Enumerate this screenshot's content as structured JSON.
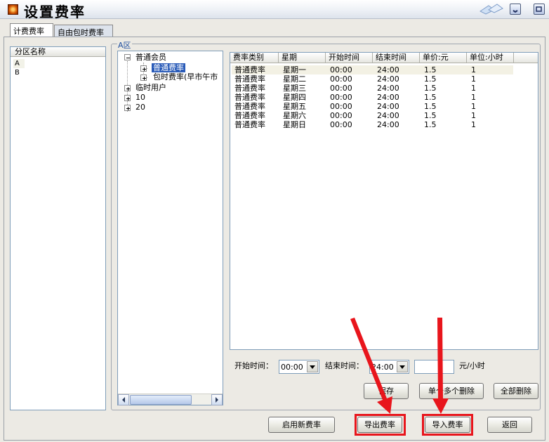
{
  "window": {
    "title": "设置费率"
  },
  "tabs": [
    {
      "label": "计费费率"
    },
    {
      "label": "自由包时费率"
    }
  ],
  "zone_list": {
    "header": "分区名称",
    "items": [
      "A",
      "B"
    ]
  },
  "group": {
    "label": "A区"
  },
  "tree": {
    "root1": "普通会员",
    "child1": "普通费率",
    "child2": "包时费率(早市午市",
    "root2": "临时用户",
    "root3": "10",
    "root4": "20"
  },
  "grid": {
    "columns": [
      "费率类别",
      "星期",
      "开始时间",
      "结束时间",
      "单价:元",
      "单位:小时"
    ],
    "rows": [
      [
        "普通费率",
        "星期一",
        "00:00",
        "24:00",
        "1.5",
        "1"
      ],
      [
        "普通费率",
        "星期二",
        "00:00",
        "24:00",
        "1.5",
        "1"
      ],
      [
        "普通费率",
        "星期三",
        "00:00",
        "24:00",
        "1.5",
        "1"
      ],
      [
        "普通费率",
        "星期四",
        "00:00",
        "24:00",
        "1.5",
        "1"
      ],
      [
        "普通费率",
        "星期五",
        "00:00",
        "24:00",
        "1.5",
        "1"
      ],
      [
        "普通费率",
        "星期六",
        "00:00",
        "24:00",
        "1.5",
        "1"
      ],
      [
        "普通费率",
        "星期日",
        "00:00",
        "24:00",
        "1.5",
        "1"
      ]
    ]
  },
  "form": {
    "start_label": "开始时间：",
    "start_value": "00:00",
    "end_label": "结束时间：",
    "end_value": "24:00",
    "price_value": "",
    "unit_label": "元/小时"
  },
  "buttons": {
    "save": "保存",
    "delete_multi": "单个多个删除",
    "delete_all": "全部删除",
    "enable_new": "启用新费率",
    "export": "导出费率",
    "import": "导入费率",
    "back": "返回"
  },
  "colors": {
    "highlight": "#e8151c",
    "tree_selection": "#2a5bb8",
    "group_label": "#1f4fa0"
  }
}
